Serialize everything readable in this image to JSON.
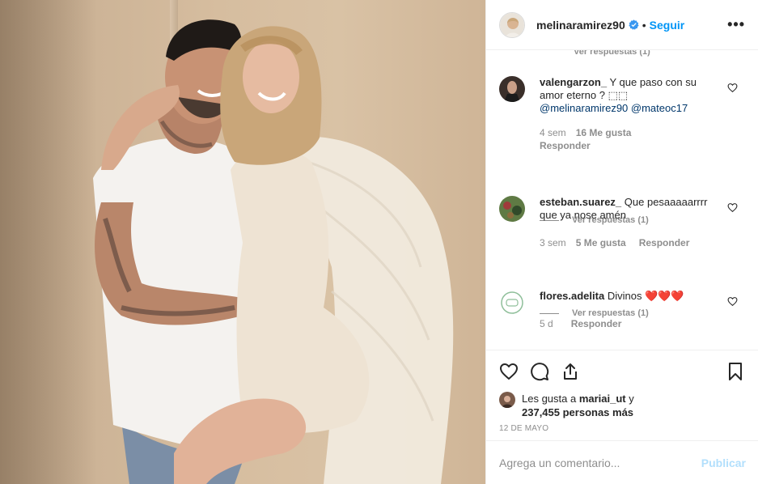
{
  "post": {
    "author": "melinaramirez90",
    "follow_label": "Seguir",
    "separator": "•",
    "more_label": "•••",
    "partial_reply_text": "Ver respuestas (1)",
    "comments": [
      {
        "user": "valengarzon_",
        "text": " Y que paso con su amor eterno ? ⬚⬚",
        "mentions": "@melinaramirez90 @mateoc17",
        "time": "4 sem",
        "likes": "16 Me gusta",
        "reply_label": "Responder",
        "view_replies": "Ver respuestas (1)"
      },
      {
        "user": "esteban.suarez_",
        "text": " Que pesaaaaarrrr que ya nose amén",
        "time": "3 sem",
        "likes": "5 Me gusta",
        "reply_label": "Responder",
        "view_replies": "Ver respuestas (1)"
      },
      {
        "user": "flores.adelita",
        "text": " Divinos ",
        "emoji": "❤️❤️❤️",
        "time": "5 d",
        "reply_label": "Responder"
      }
    ],
    "liked_by_prefix": "Les gusta a ",
    "liked_by_user": "mariai_ut",
    "liked_by_mid": " y ",
    "liked_by_count": "237,455 personas más",
    "date": "12 DE MAYO",
    "comment_placeholder": "Agrega un comentario...",
    "publish_label": "Publicar"
  },
  "colors": {
    "link_blue": "#0095f6",
    "muted": "#8e8e8e",
    "mention": "#00376b",
    "publish_disabled": "#b2dffc",
    "verified": "#3897f0"
  },
  "icons": [
    "heart-icon",
    "comment-icon",
    "share-icon",
    "bookmark-icon",
    "verified-badge-icon",
    "more-options-icon"
  ]
}
